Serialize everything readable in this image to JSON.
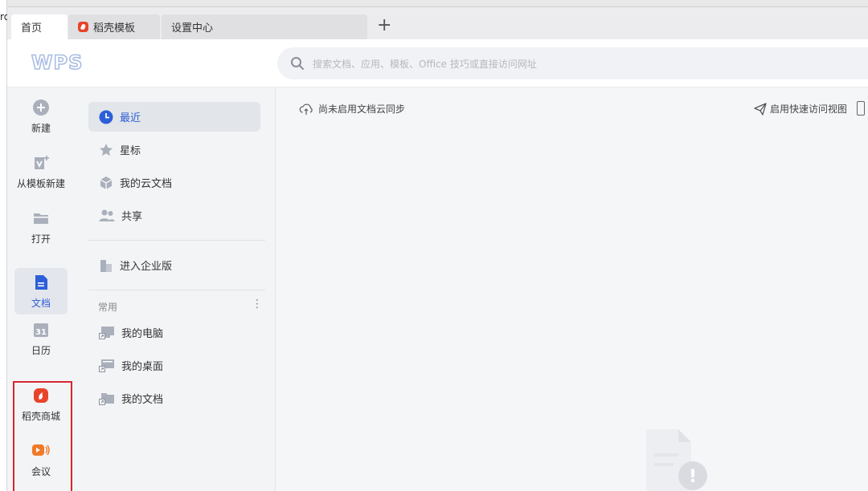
{
  "edge_text": "rd",
  "tabs": [
    {
      "label": "首页",
      "active": true
    },
    {
      "label": "稻壳模板",
      "active": false
    },
    {
      "label": "设置中心",
      "active": false
    }
  ],
  "add_tab_label": "+",
  "logo_text": "WPS",
  "search": {
    "placeholder": "搜索文档、应用、模板、Office 技巧或直接访问网址"
  },
  "rail": [
    {
      "label": "新建",
      "icon": "plus-circle-icon"
    },
    {
      "label": "从模板新建",
      "icon": "template-icon"
    },
    {
      "label": "打开",
      "icon": "folder-icon"
    },
    {
      "label": "文档",
      "icon": "document-icon",
      "active": true
    },
    {
      "label": "日历",
      "icon": "calendar-icon",
      "calendar_day": "31"
    },
    {
      "label": "稻壳商城",
      "icon": "docer-icon"
    },
    {
      "label": "会议",
      "icon": "meeting-icon"
    }
  ],
  "sidebar": {
    "items": [
      {
        "label": "最近",
        "icon": "clock-icon",
        "active": true
      },
      {
        "label": "星标",
        "icon": "star-icon"
      },
      {
        "label": "我的云文档",
        "icon": "cloud-box-icon"
      },
      {
        "label": "共享",
        "icon": "share-people-icon"
      }
    ],
    "enterprise": {
      "label": "进入企业版",
      "icon": "building-icon"
    },
    "section_title": "常用",
    "section_menu": "⋮",
    "common": [
      {
        "label": "我的电脑",
        "icon": "computer-shortcut-icon"
      },
      {
        "label": "我的桌面",
        "icon": "desktop-shortcut-icon"
      },
      {
        "label": "我的文档",
        "icon": "folder-shortcut-icon"
      }
    ]
  },
  "main": {
    "sync_status": "尚未启用文档云同步",
    "quick_access": "启用快速访问视图",
    "empty_state_badge": "!"
  },
  "colors": {
    "accent": "#2d5fd8",
    "brand_red": "#e8442a",
    "highlight_box": "#d8262f",
    "icon_gray": "#aab0bb"
  }
}
